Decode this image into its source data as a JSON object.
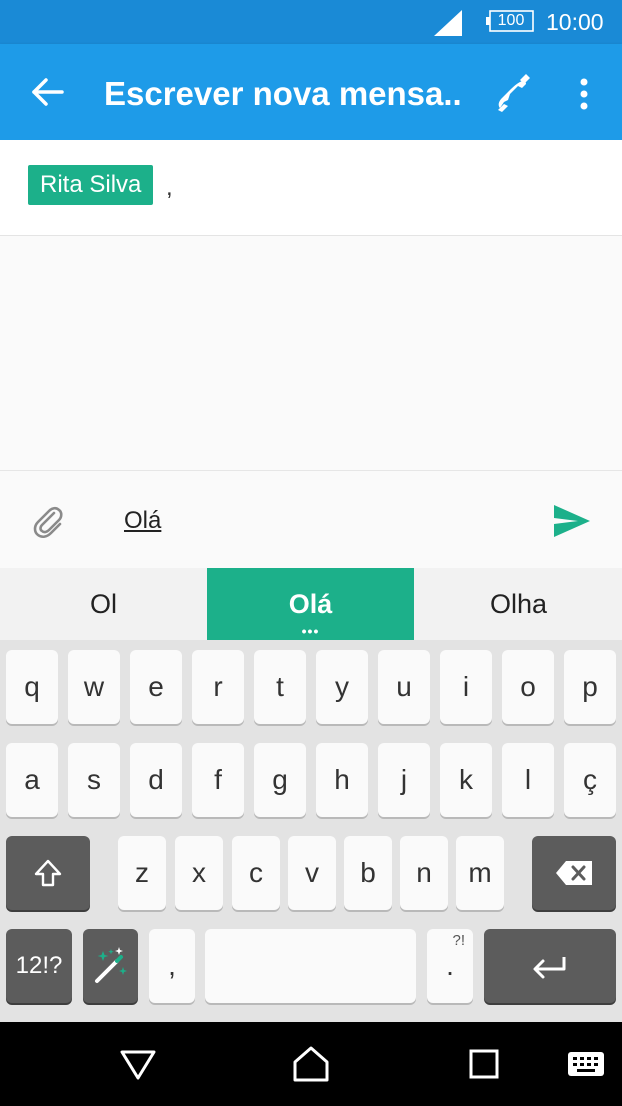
{
  "status_bar": {
    "battery": "100",
    "time": "10:00"
  },
  "app_bar": {
    "title": "Escrever nova mensa..."
  },
  "recipients": {
    "chip_label": "Rita Silva",
    "separator": ","
  },
  "compose": {
    "text": "Olá"
  },
  "suggestions": [
    "Ol",
    "Olá",
    "Olha"
  ],
  "suggestion_more": "•••",
  "keyboard": {
    "row1": [
      "q",
      "w",
      "e",
      "r",
      "t",
      "y",
      "u",
      "i",
      "o",
      "p"
    ],
    "row2": [
      "a",
      "s",
      "d",
      "f",
      "g",
      "h",
      "j",
      "k",
      "l",
      "ç"
    ],
    "row3": [
      "z",
      "x",
      "c",
      "v",
      "b",
      "n",
      "m"
    ],
    "symbols_label": "12!?",
    "comma": ",",
    "period": ".",
    "period_sub": "?!"
  },
  "colors": {
    "status_bar": "#1a8ad6",
    "app_bar": "#1e9be8",
    "accent": "#1cb08a"
  },
  "icons": {
    "back": "arrow-left-icon",
    "call": "phone-icon",
    "more": "more-vert-icon",
    "attach": "paperclip-icon",
    "send": "send-icon",
    "shift": "shift-icon",
    "backspace": "backspace-icon",
    "magic": "magic-wand-icon",
    "enter": "enter-icon",
    "nav_back": "triangle-back-icon",
    "nav_home": "home-icon",
    "nav_recent": "square-recent-icon",
    "nav_keyboard": "keyboard-icon"
  }
}
